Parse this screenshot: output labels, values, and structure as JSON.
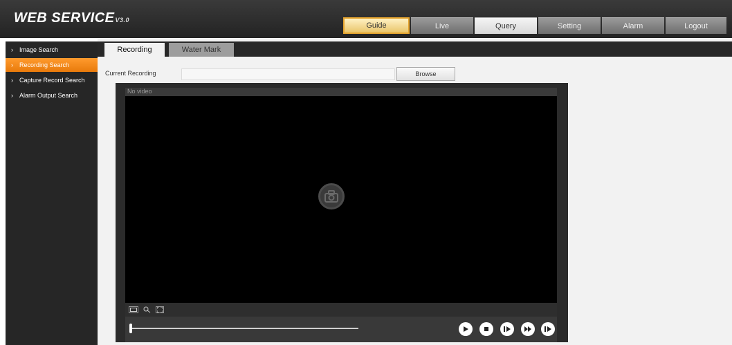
{
  "app": {
    "title": "WEB  SERVICE",
    "version": "V3.0"
  },
  "nav": {
    "guide": "Guide",
    "live": "Live",
    "query": "Query",
    "setting": "Setting",
    "alarm": "Alarm",
    "logout": "Logout"
  },
  "sidebar": {
    "items": [
      {
        "label": "Image Search"
      },
      {
        "label": "Recording Search"
      },
      {
        "label": "Capture Record Search"
      },
      {
        "label": "Alarm Output Search"
      }
    ]
  },
  "tabs": {
    "recording": "Recording",
    "watermark": "Water Mark"
  },
  "form": {
    "current_recording_label": "Current Recording",
    "current_recording_value": "",
    "browse_label": "Browse"
  },
  "player": {
    "status_text": "No video",
    "progress": 0
  },
  "colors": {
    "accent": "#f28a1a",
    "header": "#2c2c2c",
    "active_tab": "#f5d67a"
  }
}
